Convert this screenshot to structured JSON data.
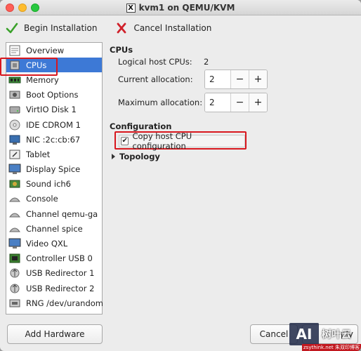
{
  "window": {
    "title": "kvm1 on QEMU/KVM",
    "x_glyph": "X"
  },
  "toolbar": {
    "begin_label": "Begin Installation",
    "cancel_label": "Cancel Installation"
  },
  "sidebar": {
    "items": [
      {
        "label": "Overview",
        "icon": "overview-icon"
      },
      {
        "label": "CPUs",
        "icon": "cpu-icon"
      },
      {
        "label": "Memory",
        "icon": "memory-icon"
      },
      {
        "label": "Boot Options",
        "icon": "boot-options-icon"
      },
      {
        "label": "VirtIO Disk 1",
        "icon": "disk-icon"
      },
      {
        "label": "IDE CDROM 1",
        "icon": "cdrom-icon"
      },
      {
        "label": "NIC :2c:cb:67",
        "icon": "nic-icon"
      },
      {
        "label": "Tablet",
        "icon": "tablet-icon"
      },
      {
        "label": "Display Spice",
        "icon": "display-icon"
      },
      {
        "label": "Sound ich6",
        "icon": "sound-icon"
      },
      {
        "label": "Console",
        "icon": "console-icon"
      },
      {
        "label": "Channel qemu-ga",
        "icon": "channel-icon"
      },
      {
        "label": "Channel spice",
        "icon": "channel-icon"
      },
      {
        "label": "Video QXL",
        "icon": "video-icon"
      },
      {
        "label": "Controller USB 0",
        "icon": "controller-icon"
      },
      {
        "label": "USB Redirector 1",
        "icon": "usb-icon"
      },
      {
        "label": "USB Redirector 2",
        "icon": "usb-icon"
      },
      {
        "label": "RNG /dev/urandom",
        "icon": "rng-icon"
      }
    ],
    "selected": "CPUs",
    "add_hardware_label": "Add Hardware"
  },
  "cpus": {
    "heading": "CPUs",
    "logical_label": "Logical host CPUs:",
    "logical_value": "2",
    "current_label": "Current allocation:",
    "current_value": "2",
    "maximum_label": "Maximum allocation:",
    "maximum_value": "2",
    "minus": "−",
    "plus": "+"
  },
  "configuration": {
    "heading": "Configuration",
    "copy_label": "Copy host CPU configuration",
    "copy_checked": true,
    "topology_label": "Topology"
  },
  "footer": {
    "cancel_label": "Cancel",
    "apply_partial": "ply"
  },
  "watermark": {
    "logo": "AI",
    "text": "树叶云",
    "sub": "zsythink.net 朱双印博客"
  },
  "colors": {
    "selection": "#3d79d6",
    "highlight": "#d8171e",
    "check_green": "#3aa12a",
    "cancel_red": "#d0202a"
  }
}
